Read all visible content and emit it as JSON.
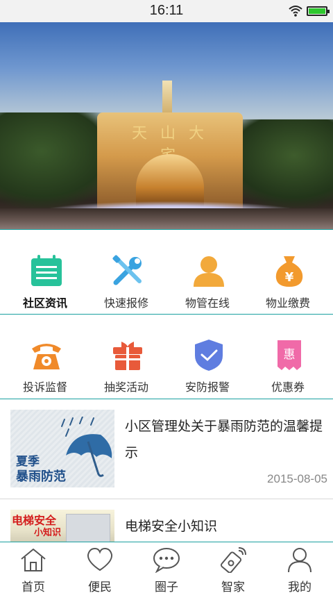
{
  "status_bar": {
    "time": "16:11"
  },
  "banner": {
    "sign_text": "天 山 大 宅",
    "dot_count": 4
  },
  "grid": {
    "row1": [
      {
        "label": "社区资讯",
        "icon": "calendar-list-icon",
        "color": "#27c29a",
        "active": true
      },
      {
        "label": "快速报修",
        "icon": "tools-icon",
        "color": "#3aa3e0",
        "active": false
      },
      {
        "label": "物管在线",
        "icon": "person-icon",
        "color": "#f2a93b",
        "active": false
      },
      {
        "label": "物业缴费",
        "icon": "money-bag-icon",
        "color": "#f29a2e",
        "active": false
      }
    ],
    "row2": [
      {
        "label": "投诉监督",
        "icon": "telephone-icon",
        "color": "#f08a2a",
        "active": false
      },
      {
        "label": "抽奖活动",
        "icon": "gift-icon",
        "color": "#e85a3a",
        "active": false
      },
      {
        "label": "安防报警",
        "icon": "shield-check-icon",
        "color": "#5f7de0",
        "active": false
      },
      {
        "label": "优惠券",
        "icon": "coupon-icon",
        "color": "#f06aa8",
        "active": false
      }
    ]
  },
  "news": [
    {
      "title": "小区管理处关于暴雨防范的温馨提示",
      "date": "2015-08-05",
      "thumb_text_line1": "夏季",
      "thumb_text_line2": "暴雨防范"
    },
    {
      "title": "电梯安全小知识",
      "date": "",
      "thumb_text_line1": "电梯安全",
      "thumb_text_line2": "小知识"
    }
  ],
  "tab_bar": [
    {
      "label": "首页",
      "icon": "home-icon"
    },
    {
      "label": "便民",
      "icon": "heart-icon"
    },
    {
      "label": "圈子",
      "icon": "chat-bubble-icon"
    },
    {
      "label": "智家",
      "icon": "smart-home-remote-icon"
    },
    {
      "label": "我的",
      "icon": "user-icon"
    }
  ],
  "colors": {
    "accent": "#19a0a0",
    "battery": "#2ec72e"
  }
}
